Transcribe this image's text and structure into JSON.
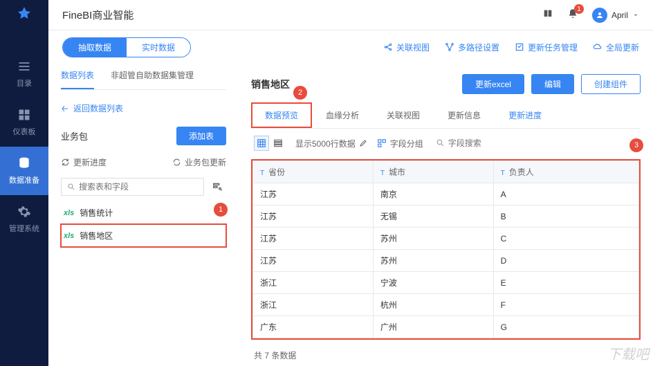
{
  "app": {
    "title": "FineBI商业智能",
    "user_name": "April",
    "notif_count": "1"
  },
  "nav": {
    "items": [
      {
        "label": "目录"
      },
      {
        "label": "仪表板"
      },
      {
        "label": "数据准备"
      },
      {
        "label": "管理系统"
      }
    ]
  },
  "toggle": {
    "extract": "抽取数据",
    "realtime": "实时数据"
  },
  "quick": {
    "relation": "关联视图",
    "multipath": "多路径设置",
    "task": "更新任务管理",
    "global": "全局更新"
  },
  "sidebar": {
    "tab1": "数据列表",
    "tab2": "非超管自助数据集管理",
    "back": "返回数据列表",
    "pkg_title": "业务包",
    "add_table": "添加表",
    "refresh": "更新进度",
    "pkg_refresh": "业务包更新",
    "search_ph": "搜索表和字段",
    "tables": [
      {
        "name": "销售统计"
      },
      {
        "name": "销售地区"
      }
    ]
  },
  "main": {
    "title": "销售地区",
    "btn_excel": "更新excel",
    "btn_edit": "编辑",
    "btn_create": "创建组件",
    "tabs": {
      "preview": "数据预览",
      "lineage": "血缘分析",
      "relation": "关联视图",
      "update_info": "更新信息",
      "update_prog": "更新进度"
    },
    "toolbar": {
      "rows": "显示5000行数据",
      "group": "字段分组",
      "search_ph": "字段搜索"
    },
    "columns": {
      "c1": "省份",
      "c2": "城市",
      "c3": "负责人"
    },
    "rows": [
      {
        "c1": "江苏",
        "c2": "南京",
        "c3": "A"
      },
      {
        "c1": "江苏",
        "c2": "无锡",
        "c3": "B"
      },
      {
        "c1": "江苏",
        "c2": "苏州",
        "c3": "C"
      },
      {
        "c1": "江苏",
        "c2": "苏州",
        "c3": "D"
      },
      {
        "c1": "浙江",
        "c2": "宁波",
        "c3": "E"
      },
      {
        "c1": "浙江",
        "c2": "杭州",
        "c3": "F"
      },
      {
        "c1": "广东",
        "c2": "广州",
        "c3": "G"
      }
    ],
    "footer": "共 7 条数据"
  },
  "callouts": {
    "n1": "1",
    "n2": "2",
    "n3": "3"
  },
  "watermark": "下载吧"
}
